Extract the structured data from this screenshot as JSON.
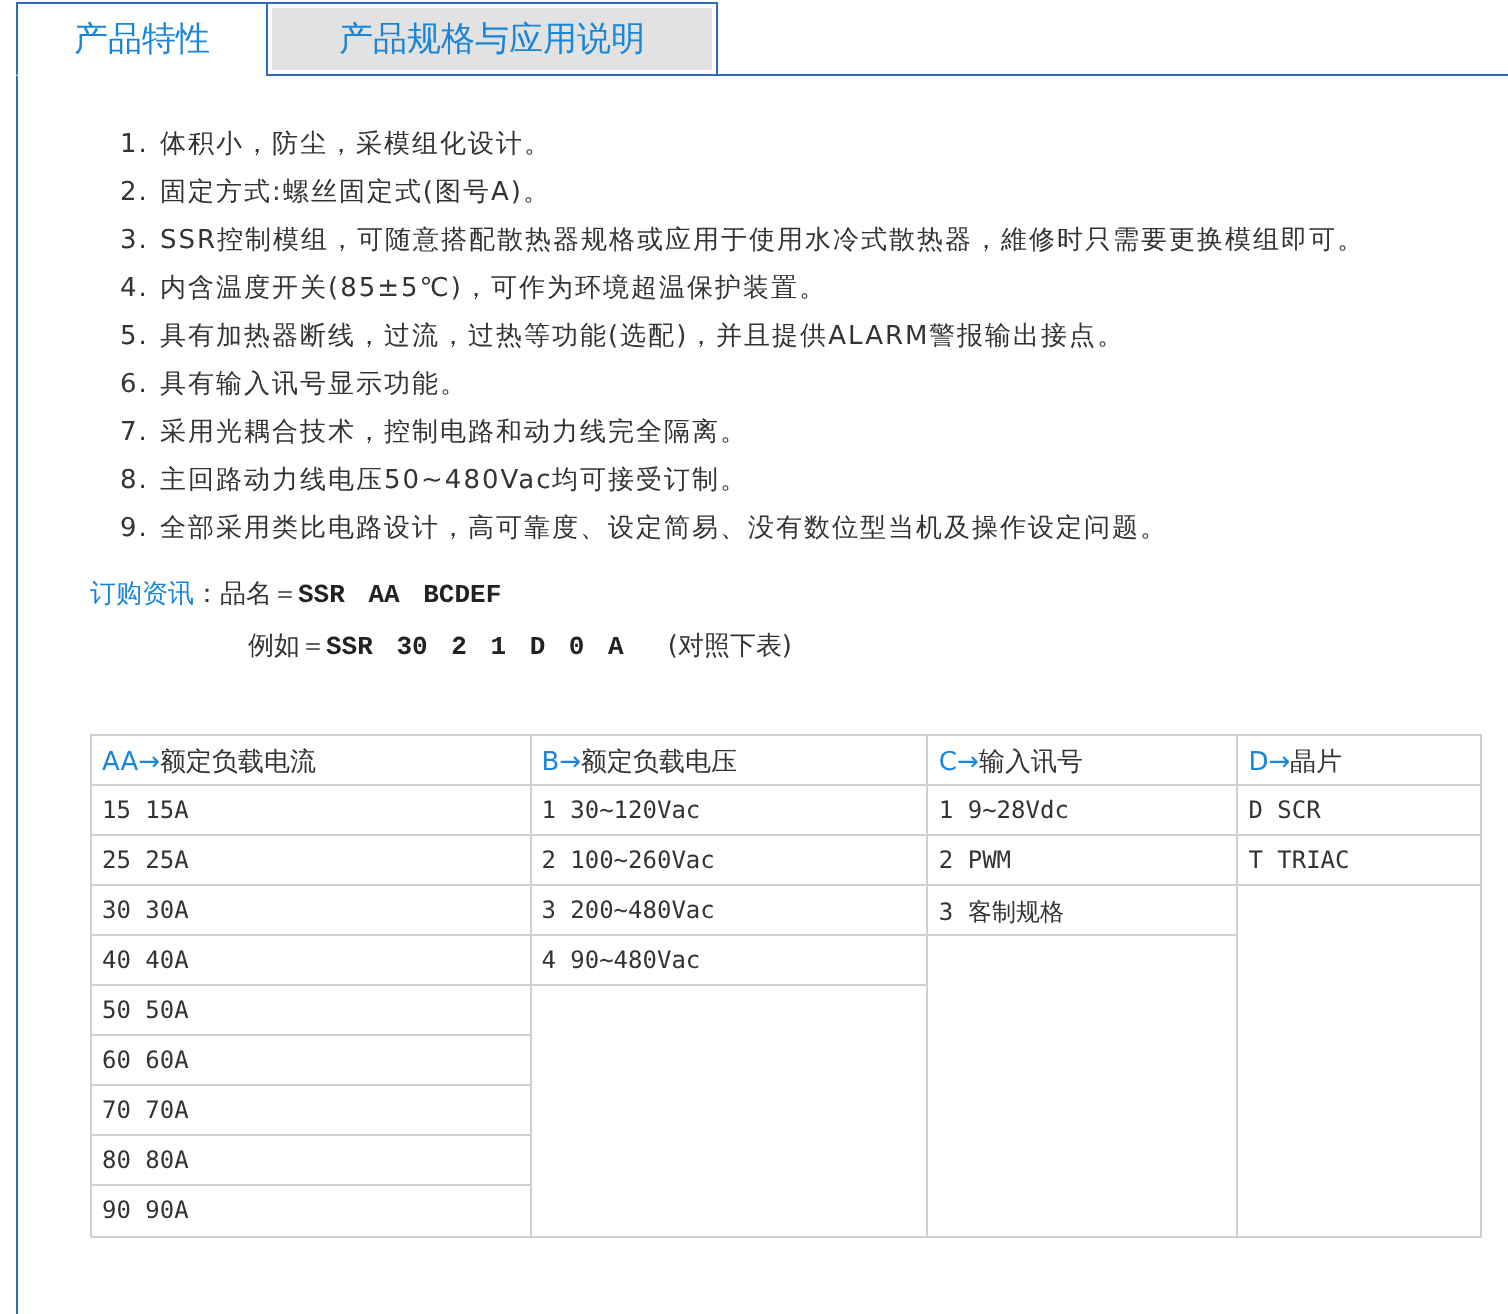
{
  "tabs": [
    {
      "label": "产品特性",
      "selected": true
    },
    {
      "label": "产品规格与应用说明",
      "selected": false
    }
  ],
  "features": [
    {
      "number": "1.",
      "text": "体积小，防尘，采模组化设计。"
    },
    {
      "number": "2.",
      "text": "固定方式:螺丝固定式(图号A)。"
    },
    {
      "number": "3.",
      "text": "SSR控制模组，可随意搭配散热器规格或应用于使用水冷式散热器，維修时只需要更换模组即可。"
    },
    {
      "number": "4.",
      "text": "内含温度开关(85±5℃)，可作为环境超温保护装置。"
    },
    {
      "number": "5.",
      "text": "具有加热器断线，过流，过热等功能(选配)，并且提供ALARM警报输出接点。"
    },
    {
      "number": "6.",
      "text": "具有输入讯号显示功能。"
    },
    {
      "number": "7.",
      "text": "采用光耦合技术，控制电路和动力线完全隔离。"
    },
    {
      "number": "8.",
      "text": "主回路动力线电压50~480Vac均可接受订制。"
    },
    {
      "number": "9.",
      "text": "全部采用类比电路设计，高可靠度、设定简易、没有数位型当机及操作设定问题。"
    }
  ],
  "order_info": {
    "heading": "订购资讯",
    "separator": "：",
    "name_label": "品名＝",
    "name_code": "SSR AA BCDEF",
    "example_label": "例如＝",
    "example_code": "SSR 30 2 1 D 0 A",
    "example_note": "(对照下表)"
  },
  "table": {
    "columns": [
      {
        "code": "AA→",
        "label": "额定负载电流",
        "rows": [
          "15 15A",
          "25 25A",
          "30 30A",
          "40 40A",
          "50 50A",
          "60 60A",
          "70 70A",
          "80 80A",
          "90 90A"
        ]
      },
      {
        "code": "B→",
        "label": "额定负载电压",
        "rows": [
          "1 30~120Vac",
          "2 100~260Vac",
          "3 200~480Vac",
          "4 90~480Vac"
        ]
      },
      {
        "code": "C→",
        "label": "输入讯号",
        "rows": [
          "1 9~28Vdc",
          "2 PWM",
          "3 客制规格"
        ]
      },
      {
        "code": "D→",
        "label": "晶片",
        "rows": [
          "D SCR",
          "T TRIAC"
        ]
      }
    ]
  }
}
